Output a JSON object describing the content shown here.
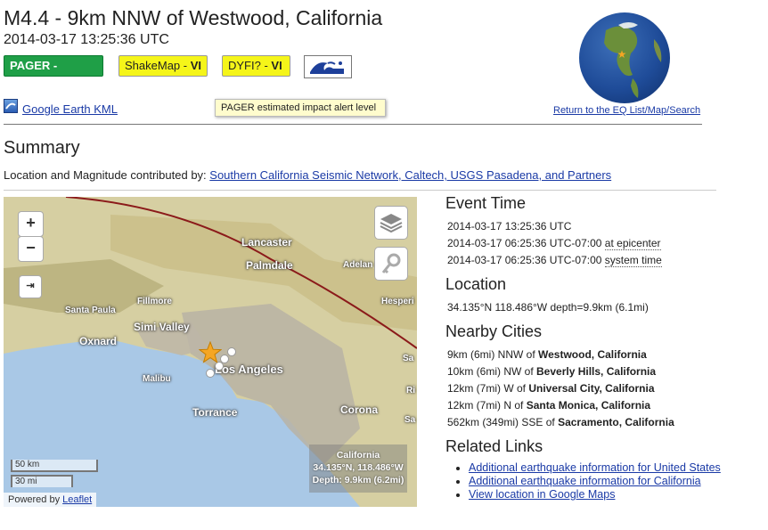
{
  "header": {
    "title": "M4.4 - 9km NNW of Westwood, California",
    "time": "2014-03-17 13:25:36 UTC"
  },
  "badges": {
    "pager_label": "PAGER - GREEN",
    "shakemap_label": "ShakeMap - ",
    "shakemap_value": "VI",
    "dyfi_label": "DYFI? - ",
    "dyfi_value": "VI",
    "tsunami_icon": "tsunami-icon"
  },
  "tooltip": "PAGER estimated impact alert level",
  "kml_link": "Google Earth KML",
  "return_link": "Return to the EQ List/Map/Search",
  "summary": {
    "title": "Summary",
    "contributed_label": "Location and Magnitude contributed by: ",
    "contributed_link": "Southern California Seismic Network, Caltech, USGS Pasadena, and Partners"
  },
  "map": {
    "zoom_in": "+",
    "zoom_out": "−",
    "fullscreen": "⇥",
    "scale_km": "50 km",
    "scale_mi": "30 mi",
    "attribution_prefix": "Powered by ",
    "attribution_link": "Leaflet",
    "cities": [
      "Lancaster",
      "Palmdale",
      "Adelan",
      "Hesperi",
      "Fillmore",
      "Santa Paula",
      "Simi Valley",
      "Oxnard",
      "Malibu",
      "Los Angeles",
      "Torrance",
      "Corona",
      "Sa",
      "Ri",
      "Sa"
    ],
    "region_box": {
      "name": "California",
      "coords": "34.135°N, 118.486°W",
      "depth": "Depth: 9.9km (6.2mi)"
    },
    "colors": {
      "fault": "#8b1a1a",
      "star": "#f5a623",
      "land": "#d7cfa8",
      "urban": "#b8b0a0"
    }
  },
  "event_time": {
    "title": "Event Time",
    "utc": "2014-03-17 13:25:36 UTC",
    "local": "2014-03-17 06:25:36 UTC-07:00",
    "local_suffix": "at epicenter",
    "system": "2014-03-17 06:25:36 UTC-07:00",
    "system_suffix": "system time"
  },
  "location": {
    "title": "Location",
    "text": "34.135°N 118.486°W depth=9.9km (6.1mi)"
  },
  "nearby": {
    "title": "Nearby Cities",
    "items": [
      {
        "dist": "9km (6mi) NNW of ",
        "city": "Westwood, California"
      },
      {
        "dist": "10km (6mi) NW of ",
        "city": "Beverly Hills, California"
      },
      {
        "dist": "12km (7mi) W of ",
        "city": "Universal City, California"
      },
      {
        "dist": "12km (7mi) N of ",
        "city": "Santa Monica, California"
      },
      {
        "dist": "562km (349mi) SSE of ",
        "city": "Sacramento, California"
      }
    ]
  },
  "related": {
    "title": "Related Links",
    "links": [
      "Additional earthquake information for United States",
      "Additional earthquake information for California",
      "View location in Google Maps"
    ]
  }
}
